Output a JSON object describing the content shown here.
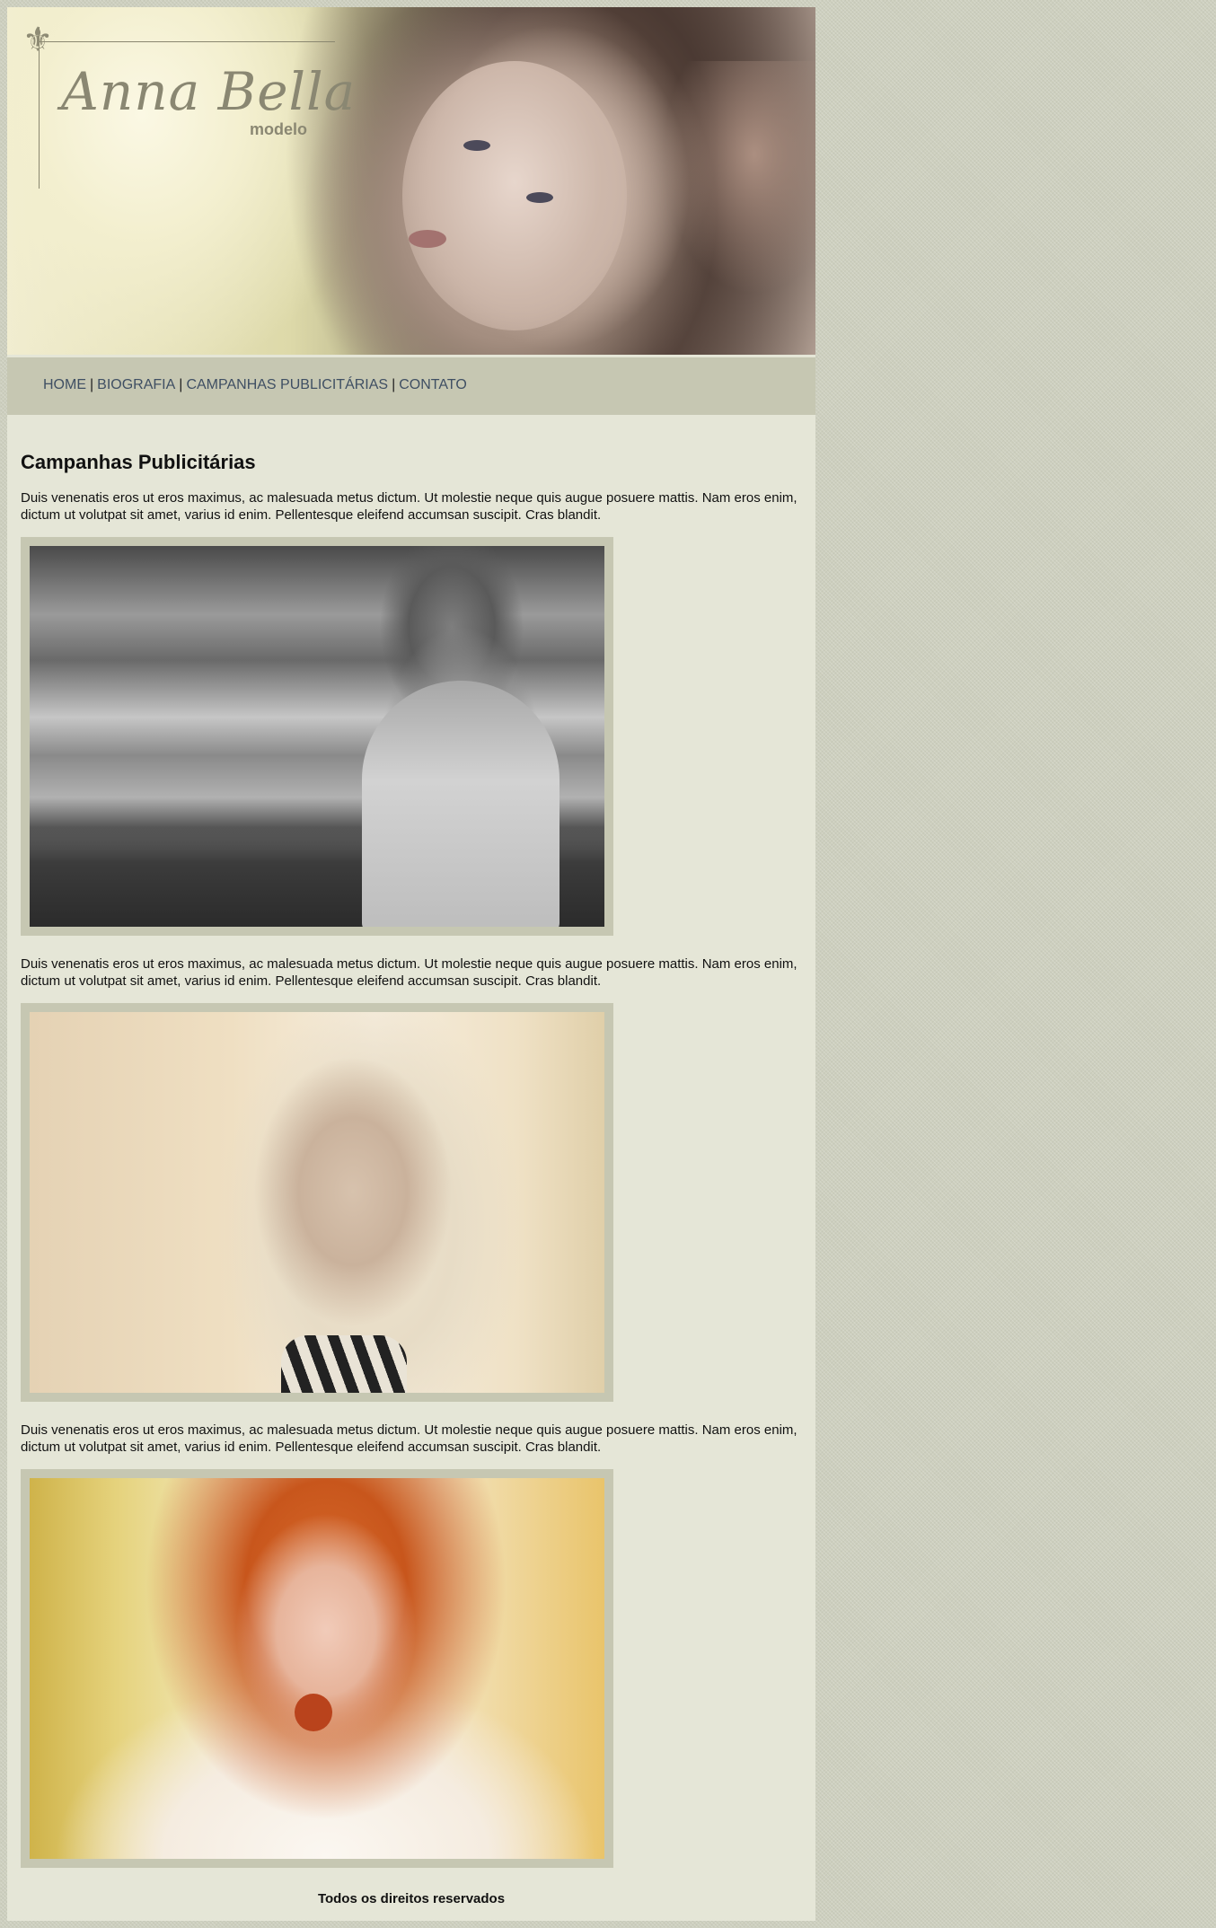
{
  "header": {
    "brand_name": "Anna Bella",
    "brand_tagline": "modelo",
    "banner_image": "model-portrait-banner"
  },
  "nav": {
    "items": [
      {
        "label": "HOME"
      },
      {
        "label": "BIOGRAFIA"
      },
      {
        "label": "CAMPANHAS PUBLICITÁRIAS"
      },
      {
        "label": "CONTATO"
      }
    ],
    "separator": "|"
  },
  "main": {
    "title": "Campanhas Publicitárias",
    "sections": [
      {
        "text": "Duis venenatis eros ut eros maximus, ac malesuada metus dictum. Ut molestie neque quis augue posuere mattis. Nam eros enim, dictum ut volutpat sit amet, varius id enim. Pellentesque eleifend accumsan suscipit. Cras blandit.",
        "image": "campaign-photo-bw-seaside"
      },
      {
        "text": "Duis venenatis eros ut eros maximus, ac malesuada metus dictum. Ut molestie neque quis augue posuere mattis. Nam eros enim, dictum ut volutpat sit amet, varius id enim. Pellentesque eleifend accumsan suscipit. Cras blandit.",
        "image": "campaign-photo-blonde"
      },
      {
        "text": "Duis venenatis eros ut eros maximus, ac malesuada metus dictum. Ut molestie neque quis augue posuere mattis. Nam eros enim, dictum ut volutpat sit amet, varius id enim. Pellentesque eleifend accumsan suscipit. Cras blandit.",
        "image": "campaign-photo-redhead"
      }
    ]
  },
  "footer": {
    "text": "Todos os direitos reservados"
  },
  "colors": {
    "page_background": "#cdcfbe",
    "content_background": "#e5e6d7",
    "nav_background": "#c6c7b2",
    "link_color": "#3f4f63",
    "frame_color": "#c6c7b2"
  }
}
